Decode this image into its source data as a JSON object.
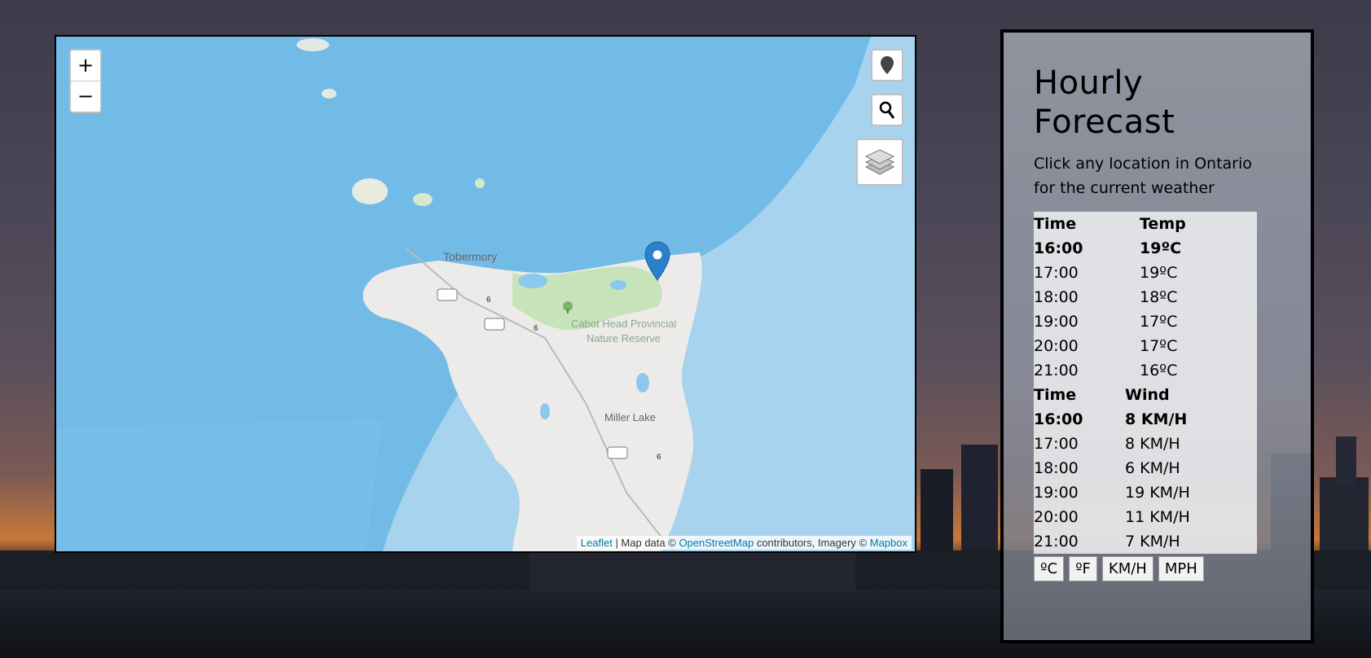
{
  "map": {
    "zoom_in": "+",
    "zoom_out": "−",
    "labels": {
      "tobermory": "Tobermory",
      "cabot_line1": "Cabot Head Provincial",
      "cabot_line2": "Nature Reserve",
      "miller_lake": "Miller Lake",
      "route": "6"
    },
    "attribution": {
      "leaflet": "Leaflet",
      "sep": " | Map data © ",
      "osm": "OpenStreetMap",
      "mid": " contributors, Imagery © ",
      "mapbox": "Mapbox"
    },
    "controls": [
      "marker-icon",
      "search-icon",
      "layers-icon"
    ]
  },
  "panel": {
    "title_line1": "Hourly",
    "title_line2": "Forecast",
    "subtitle": "Click any location in Ontario for the current weather",
    "temp_table": {
      "headers": [
        "Time",
        "Temp"
      ],
      "rows": [
        [
          "16:00",
          "19ºC"
        ],
        [
          "17:00",
          "19ºC"
        ],
        [
          "18:00",
          "18ºC"
        ],
        [
          "19:00",
          "17ºC"
        ],
        [
          "20:00",
          "17ºC"
        ],
        [
          "21:00",
          "16ºC"
        ]
      ]
    },
    "wind_table": {
      "headers": [
        "Time",
        "Wind"
      ],
      "rows": [
        [
          "16:00",
          "8 KM/H"
        ],
        [
          "17:00",
          "8 KM/H"
        ],
        [
          "18:00",
          "6 KM/H"
        ],
        [
          "19:00",
          "19 KM/H"
        ],
        [
          "20:00",
          "11 KM/H"
        ],
        [
          "21:00",
          "7 KM/H"
        ]
      ]
    },
    "buttons": {
      "celsius": "ºC",
      "fahrenheit": "ºF",
      "kmh": "KM/H",
      "mph": "MPH"
    }
  }
}
